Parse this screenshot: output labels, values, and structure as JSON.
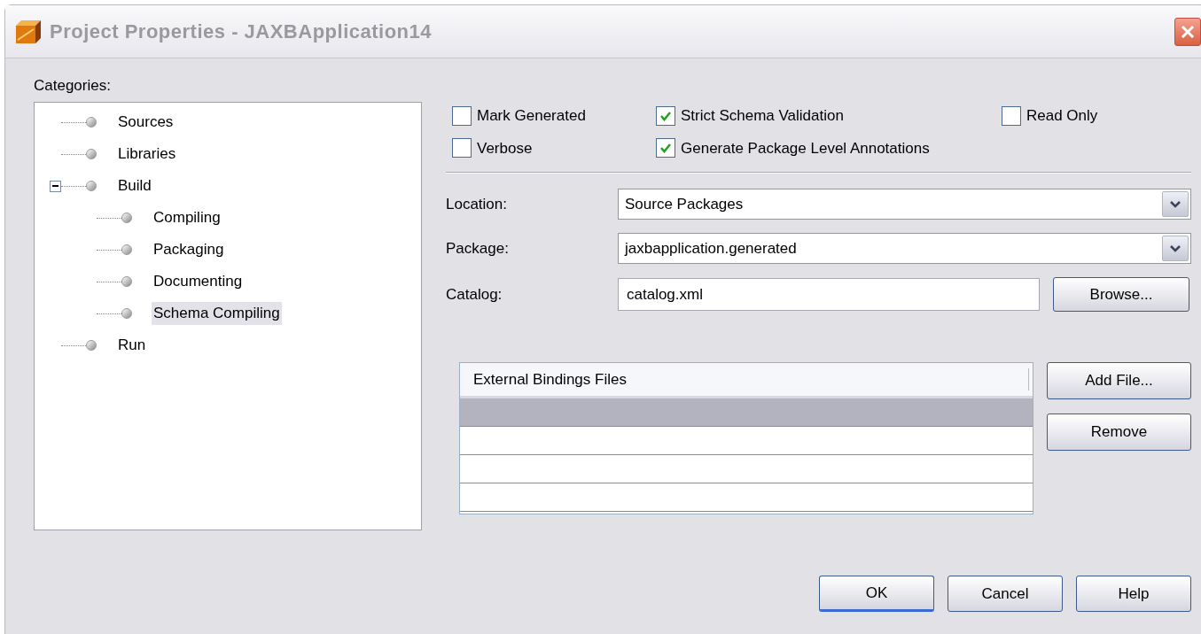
{
  "window": {
    "title": "Project Properties - JAXBApplication14"
  },
  "categories": {
    "label": "Categories:",
    "items": [
      {
        "label": "Sources",
        "selected": false
      },
      {
        "label": "Libraries",
        "selected": false
      },
      {
        "label": "Build",
        "selected": false,
        "expanded": true,
        "children": [
          {
            "label": "Compiling",
            "selected": false
          },
          {
            "label": "Packaging",
            "selected": false
          },
          {
            "label": "Documenting",
            "selected": false
          },
          {
            "label": "Schema Compiling",
            "selected": true
          }
        ]
      },
      {
        "label": "Run",
        "selected": false
      }
    ]
  },
  "options": [
    {
      "label": "Mark Generated",
      "checked": false
    },
    {
      "label": "Strict Schema Validation",
      "checked": true
    },
    {
      "label": "Read Only",
      "checked": false
    },
    {
      "label": "Verbose",
      "checked": false
    },
    {
      "label": "Generate Package Level Annotations",
      "checked": true
    }
  ],
  "fields": [
    {
      "kind": "dropdown",
      "label": "Location:",
      "value": "Source Packages"
    },
    {
      "kind": "dropdown",
      "label": "Package:",
      "value": "jaxbapplication.generated"
    },
    {
      "kind": "text",
      "label": "Catalog:",
      "value": "catalog.xml",
      "button": "Browse..."
    }
  ],
  "bindings": {
    "columns": [
      "External Bindings Files"
    ],
    "rows": [
      {
        "selected": true
      },
      {
        "selected": false
      },
      {
        "selected": false
      },
      {
        "selected": false
      }
    ],
    "buttons": [
      "Add File...",
      "Remove"
    ]
  },
  "buttons": [
    "OK",
    "Cancel",
    "Help"
  ]
}
